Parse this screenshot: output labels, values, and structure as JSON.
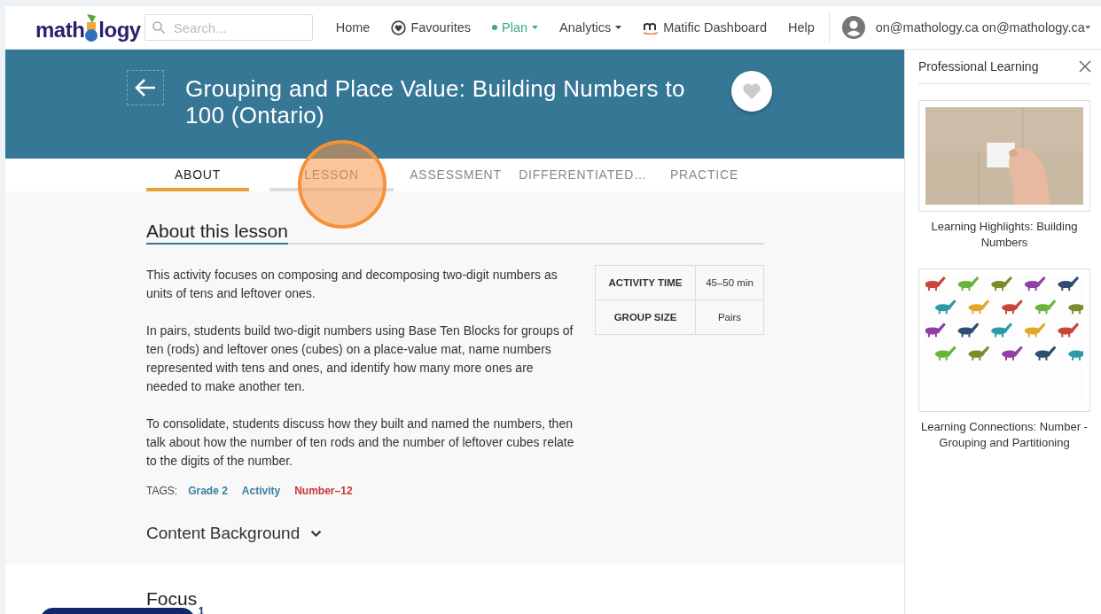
{
  "navbar": {
    "logo": {
      "before": "math",
      "after": "logy"
    },
    "search": {
      "placeholder": "Search..."
    },
    "items": [
      {
        "label": "Home",
        "kind": "plain",
        "dropdown": false,
        "selected": false
      },
      {
        "label": "Favourites",
        "kind": "heart",
        "dropdown": false,
        "selected": false
      },
      {
        "label": "Plan",
        "kind": "plain",
        "dropdown": true,
        "selected": true
      },
      {
        "label": "Analytics",
        "kind": "plain",
        "dropdown": true,
        "selected": false
      },
      {
        "label": "Matific Dashboard",
        "kind": "brand",
        "dropdown": false,
        "selected": false
      },
      {
        "label": "Help",
        "kind": "plain",
        "dropdown": false,
        "selected": false
      }
    ],
    "user": {
      "label": "on@mathology.ca on@mathology.ca"
    }
  },
  "header": {
    "title": "Grouping and Place Value: Building Numbers to 100 (Ontario)",
    "favourite": false
  },
  "tabs": [
    {
      "label": "ABOUT",
      "selected": true,
      "hovered": false
    },
    {
      "label": "LESSON",
      "selected": false,
      "hovered": true
    },
    {
      "label": "ASSESSMENT",
      "selected": false,
      "hovered": false
    },
    {
      "label": "DIFFERENTIATED…",
      "selected": false,
      "hovered": false
    },
    {
      "label": "PRACTICE",
      "selected": false,
      "hovered": false
    }
  ],
  "about": {
    "heading": "About this lesson",
    "paragraphs": [
      "This activity focuses on composing and decomposing two-digit numbers as units of tens and leftover ones.",
      "In pairs, students build two-digit numbers using Base Ten Blocks for groups of ten (rods) and leftover ones (cubes) on a place-value mat, name numbers represented with tens and ones, and identify how many more ones are needed to make another ten.",
      "To consolidate, students discuss how they built and named the numbers, then talk about how the number of ten rods and the number of leftover cubes relate to the digits of the number."
    ],
    "facts": [
      {
        "label": "ACTIVITY TIME",
        "value": "45–50 min"
      },
      {
        "label": "GROUP SIZE",
        "value": "Pairs"
      }
    ],
    "tags_label": "TAGS:",
    "tags": [
      {
        "label": "Grade 2",
        "color": "#3a7fa0"
      },
      {
        "label": "Activity",
        "color": "#3a7fa0"
      },
      {
        "label": "Number–12",
        "color": "#c8373a"
      }
    ],
    "content_background": {
      "label": "Content Background",
      "expanded": false
    }
  },
  "focus": {
    "heading": "Focus"
  },
  "launcher": {
    "badge": "1"
  },
  "sidebar": {
    "title": "Professional Learning",
    "cards": [
      {
        "kind": "card",
        "caption": "Learning Highlights: Building Numbers"
      },
      {
        "kind": "card",
        "caption": "Learning Connections: Number - Grouping and Partitioning"
      }
    ]
  }
}
